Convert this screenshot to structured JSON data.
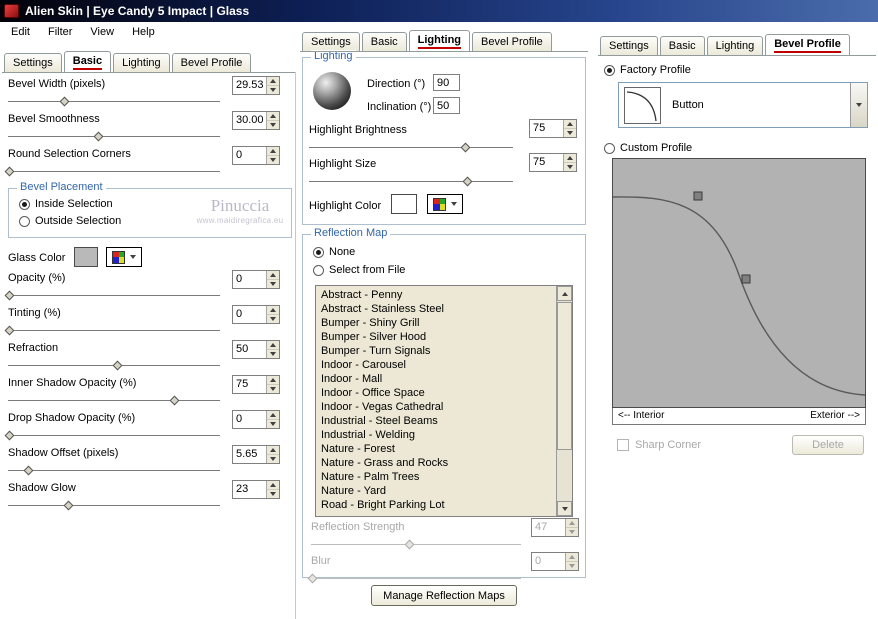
{
  "colors": {
    "titlebar_left": "#020208",
    "titlebar_right": "#4a6cab",
    "group_label": "#3366aa",
    "list_bg": "#ece8d5",
    "curve_bg": "#b2b2b2",
    "active_tab_underline": "#c00000",
    "disabled_text": "#a8a8a8",
    "glass_color_swatch": "#b9b9b9",
    "highlight_color_swatch": "#ffffff"
  },
  "window": {
    "title": "Alien Skin  |  Eye Candy 5 Impact  |  Glass",
    "menu": [
      "Edit",
      "Filter",
      "View",
      "Help"
    ]
  },
  "tabs": [
    "Settings",
    "Basic",
    "Lighting",
    "Bevel Profile"
  ],
  "left": {
    "active_tab": "Basic",
    "rows": [
      {
        "label": "Bevel Width (pixels)",
        "value": "29.53"
      },
      {
        "label": "Bevel Smoothness",
        "value": "30.00"
      },
      {
        "label": "Round Selection Corners",
        "value": "0"
      },
      {
        "label": "Opacity (%)",
        "value": "0"
      },
      {
        "label": "Tinting (%)",
        "value": "0"
      },
      {
        "label": "Refraction",
        "value": "50"
      },
      {
        "label": "Inner Shadow Opacity (%)",
        "value": "75"
      },
      {
        "label": "Drop Shadow Opacity (%)",
        "value": "0"
      },
      {
        "label": "Shadow Offset (pixels)",
        "value": "5.65"
      },
      {
        "label": "Shadow Glow",
        "value": "23"
      }
    ],
    "bevel_placement": {
      "title": "Bevel Placement",
      "options": [
        "Inside Selection",
        "Outside Selection"
      ],
      "selected": "Inside Selection"
    },
    "glass_color_label": "Glass Color",
    "watermark": {
      "name": "Pinuccia",
      "url": "www.maidiregrafica.eu"
    }
  },
  "middle": {
    "active_tab": "Lighting",
    "lighting": {
      "title": "Lighting",
      "direction_label": "Direction (°)",
      "direction": "90",
      "inclination_label": "Inclination (°)",
      "inclination": "50",
      "highlight_brightness_label": "Highlight Brightness",
      "highlight_brightness": "75",
      "highlight_size_label": "Highlight Size",
      "highlight_size": "75",
      "highlight_color_label": "Highlight Color"
    },
    "reflection": {
      "title": "Reflection Map",
      "options": [
        "None",
        "Select from File"
      ],
      "selected": "None",
      "list": [
        "Abstract - Penny",
        "Abstract - Stainless Steel",
        "Bumper - Shiny Grill",
        "Bumper - Silver Hood",
        "Bumper - Turn Signals",
        "Indoor - Carousel",
        "Indoor - Mall",
        "Indoor - Office Space",
        "Indoor - Vegas Cathedral",
        "Industrial - Steel Beams",
        "Industrial - Welding",
        "Nature - Forest",
        "Nature - Grass and Rocks",
        "Nature - Palm Trees",
        "Nature - Yard",
        "Road - Bright Parking Lot"
      ],
      "strength_label": "Reflection Strength",
      "strength": "47",
      "blur_label": "Blur",
      "blur": "0",
      "manage_button": "Manage Reflection Maps"
    }
  },
  "right": {
    "active_tab": "Bevel Profile",
    "factory_label": "Factory Profile",
    "factory_value": "Button",
    "custom_label": "Custom Profile",
    "interior_label": "<-- Interior",
    "exterior_label": "Exterior -->",
    "sharp_corner_label": "Sharp Corner",
    "delete_button": "Delete"
  }
}
